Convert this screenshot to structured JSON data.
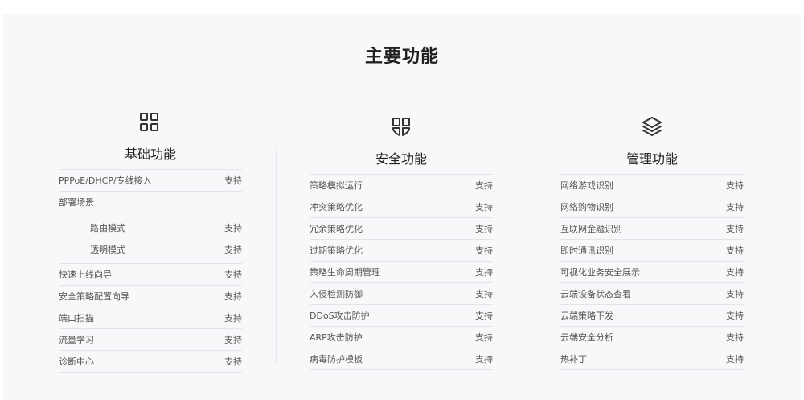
{
  "title": "主要功能",
  "columns": [
    {
      "name": "基础功能",
      "icon": "grid-icon",
      "rows": [
        {
          "label": "PPPoE/DHCP/专线接入",
          "value": "支持"
        },
        {
          "label": "部署场景",
          "value": ""
        },
        {
          "label": "路由模式",
          "value": "支持"
        },
        {
          "label": "透明模式",
          "value": "支持"
        },
        {
          "label": "快速上线向导",
          "value": "支持"
        },
        {
          "label": "安全策略配置向导",
          "value": "支持"
        },
        {
          "label": "端口扫描",
          "value": "支持"
        },
        {
          "label": "流量学习",
          "value": "支持"
        },
        {
          "label": "诊断中心",
          "value": "支持"
        }
      ]
    },
    {
      "name": "安全功能",
      "icon": "shield-icon",
      "rows": [
        {
          "label": "策略模拟运行",
          "value": "支持"
        },
        {
          "label": "冲突策略优化",
          "value": "支持"
        },
        {
          "label": "冗余策略优化",
          "value": "支持"
        },
        {
          "label": "过期策略优化",
          "value": "支持"
        },
        {
          "label": "策略生命周期管理",
          "value": "支持"
        },
        {
          "label": "入侵检测防御",
          "value": "支持"
        },
        {
          "label": "DDoS攻击防护",
          "value": "支持"
        },
        {
          "label": "ARP攻击防护",
          "value": "支持"
        },
        {
          "label": "病毒防护模板",
          "value": "支持"
        }
      ]
    },
    {
      "name": "管理功能",
      "icon": "layers-icon",
      "rows": [
        {
          "label": "网络游戏识别",
          "value": "支持"
        },
        {
          "label": "网络购物识别",
          "value": "支持"
        },
        {
          "label": "互联网金融识别",
          "value": "支持"
        },
        {
          "label": "即时通讯识别",
          "value": "支持"
        },
        {
          "label": "可视化业务安全展示",
          "value": "支持"
        },
        {
          "label": "云端设备状态查看",
          "value": "支持"
        },
        {
          "label": "云端策略下发",
          "value": "支持"
        },
        {
          "label": "云端安全分析",
          "value": "支持"
        },
        {
          "label": "热补丁",
          "value": "支持"
        }
      ]
    }
  ]
}
